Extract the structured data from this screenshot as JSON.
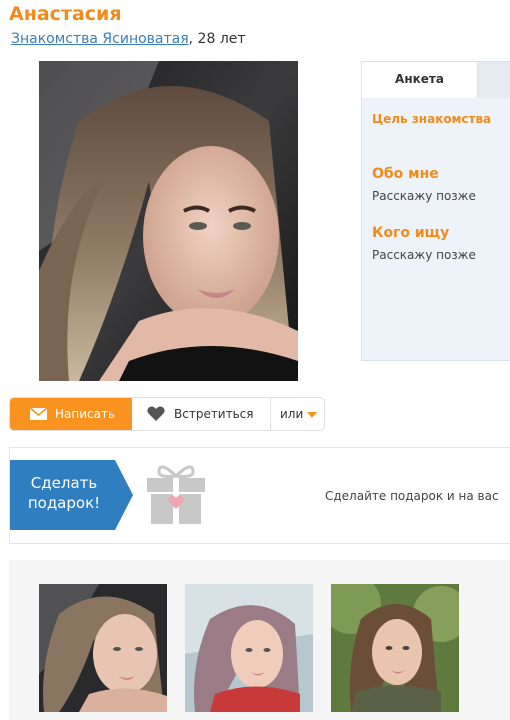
{
  "profile": {
    "name": "Анастасия",
    "location_link": "Знакомства Ясиноватая",
    "age_text": ", 28 лет"
  },
  "panel": {
    "tab": "Анкета",
    "goal_heading": "Цель знакомства",
    "about_heading": "Обо мне",
    "about_text": "Расскажу позже",
    "seek_heading": "Кого ищу",
    "seek_text": "Расскажу позже"
  },
  "actions": {
    "write_label": "Написать",
    "meet_label": "Встретиться",
    "or_label": "или"
  },
  "gift": {
    "badge_line1": "Сделать",
    "badge_line2": "подарок!",
    "promo_text": "Сделайте подарок и на вас"
  },
  "colors": {
    "accent_orange": "#f7931e",
    "link_blue": "#3a7fb5",
    "gift_blue": "#2f7fc0"
  }
}
